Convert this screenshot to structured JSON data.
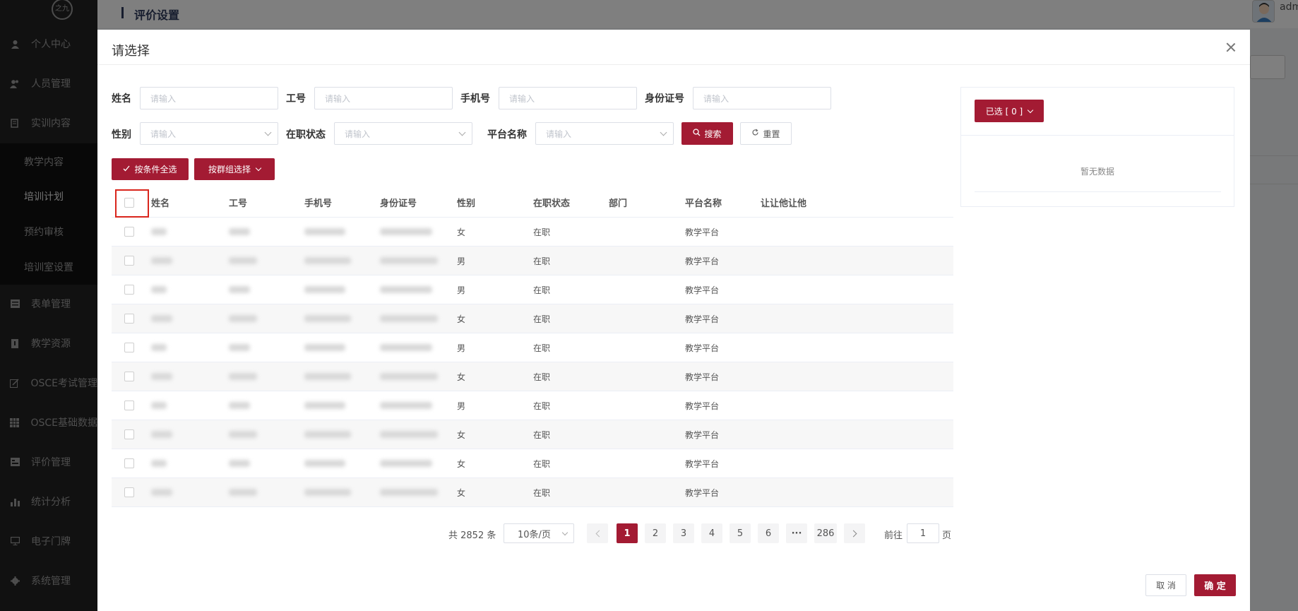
{
  "sidebar": {
    "logo_text": "之九",
    "items": [
      {
        "label": "个人中心",
        "icon": "user-icon"
      },
      {
        "label": "人员管理",
        "icon": "users-icon"
      },
      {
        "label": "实训内容",
        "icon": "book-icon"
      },
      {
        "label": "表单管理",
        "icon": "form-icon"
      },
      {
        "label": "教学资源",
        "icon": "resource-icon"
      },
      {
        "label": "OSCE考试管理",
        "icon": "edit-icon"
      },
      {
        "label": "OSCE基础数据",
        "icon": "grid-icon"
      },
      {
        "label": "评价管理",
        "icon": "rating-icon"
      },
      {
        "label": "统计分析",
        "icon": "bar-chart-icon"
      },
      {
        "label": "电子门牌",
        "icon": "monitor-icon"
      },
      {
        "label": "系统管理",
        "icon": "gear-icon"
      }
    ],
    "sub_items": [
      {
        "label": "教学内容"
      },
      {
        "label": "培训计划"
      },
      {
        "label": "预约审核"
      },
      {
        "label": "培训室设置"
      }
    ]
  },
  "page": {
    "title": "评价设置",
    "user_name": "adm"
  },
  "dialog": {
    "title": "请选择",
    "filters": {
      "name_label": "姓名",
      "name_placeholder": "请输入",
      "job_no_label": "工号",
      "job_no_placeholder": "请输入",
      "phone_label": "手机号",
      "phone_placeholder": "请输入",
      "id_card_label": "身份证号",
      "id_card_placeholder": "请输入",
      "gender_label": "性别",
      "gender_placeholder": "请输入",
      "status_label": "在职状态",
      "status_placeholder": "请输入",
      "platform_label": "平台名称",
      "platform_placeholder": "请输入"
    },
    "buttons": {
      "search": "搜索",
      "reset": "重置",
      "select_all_by_condition": "按条件全选",
      "select_by_group": "按群组选择",
      "selected": "已选 [ 0 ]",
      "cancel": "取 消",
      "confirm": "确 定"
    },
    "table": {
      "columns": [
        "姓名",
        "工号",
        "手机号",
        "身份证号",
        "性别",
        "在职状态",
        "部门",
        "平台名称",
        "让让他让他"
      ],
      "rows": [
        {
          "gender": "女",
          "status": "在职",
          "dept": "",
          "platform": "教学平台"
        },
        {
          "gender": "男",
          "status": "在职",
          "dept": "",
          "platform": "教学平台"
        },
        {
          "gender": "男",
          "status": "在职",
          "dept": "",
          "platform": "教学平台"
        },
        {
          "gender": "女",
          "status": "在职",
          "dept": "",
          "platform": "教学平台"
        },
        {
          "gender": "男",
          "status": "在职",
          "dept": "",
          "platform": "教学平台"
        },
        {
          "gender": "女",
          "status": "在职",
          "dept": "",
          "platform": "教学平台"
        },
        {
          "gender": "男",
          "status": "在职",
          "dept": "",
          "platform": "教学平台"
        },
        {
          "gender": "女",
          "status": "在职",
          "dept": "",
          "platform": "教学平台"
        },
        {
          "gender": "女",
          "status": "在职",
          "dept": "",
          "platform": "教学平台"
        },
        {
          "gender": "女",
          "status": "在职",
          "dept": "",
          "platform": "教学平台"
        }
      ]
    },
    "pagination": {
      "total": "共 2852 条",
      "page_size": "10条/页",
      "pages": [
        "1",
        "2",
        "3",
        "4",
        "5",
        "6",
        "···",
        "286"
      ],
      "current": "1",
      "goto_label": "前往",
      "goto_value": "1",
      "page_suffix": "页"
    },
    "selected_panel": {
      "empty_text": "暂无数据"
    }
  },
  "colors": {
    "primary": "#a31b33",
    "sidebar_bg": "#232323",
    "highlight_box": "#d9251c"
  }
}
